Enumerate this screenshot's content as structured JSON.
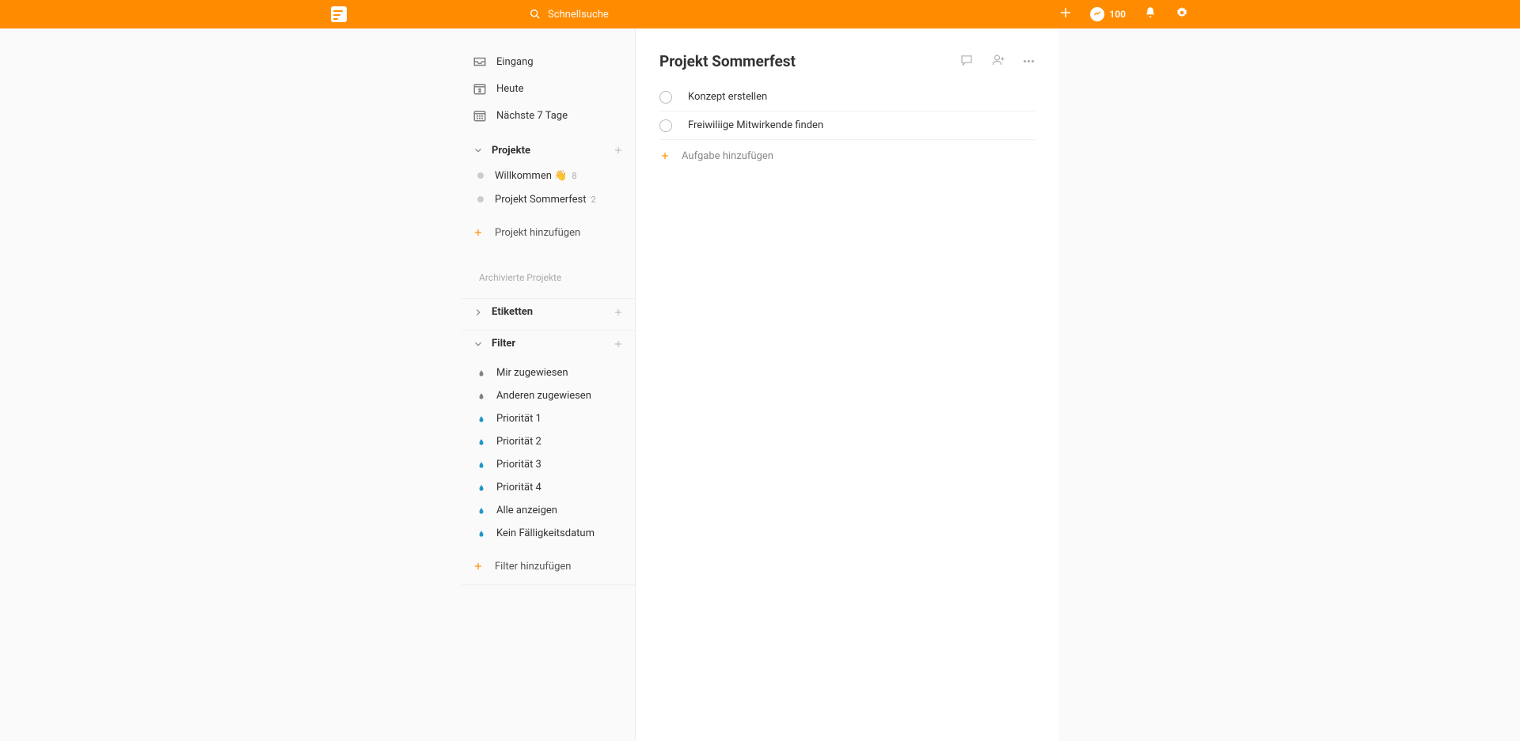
{
  "header": {
    "search_placeholder": "Schnellsuche",
    "karma_score": "100"
  },
  "sidebar": {
    "nav": {
      "inbox": "Eingang",
      "today": "Heute",
      "today_date": "2",
      "next7": "Nächste 7 Tage"
    },
    "projects": {
      "title": "Projekte",
      "items": [
        {
          "label": "Willkommen 👋",
          "count": "8"
        },
        {
          "label": "Projekt Sommerfest",
          "count": "2"
        }
      ],
      "add_label": "Projekt hinzufügen",
      "archived_label": "Archivierte Projekte"
    },
    "labels": {
      "title": "Etiketten"
    },
    "filters": {
      "title": "Filter",
      "items": [
        {
          "label": "Mir zugewiesen",
          "color": "#808080"
        },
        {
          "label": "Anderen zugewiesen",
          "color": "#808080"
        },
        {
          "label": "Priorität 1",
          "color": "#2196c9"
        },
        {
          "label": "Priorität 2",
          "color": "#2196c9"
        },
        {
          "label": "Priorität 3",
          "color": "#2196c9"
        },
        {
          "label": "Priorität 4",
          "color": "#2196c9"
        },
        {
          "label": "Alle anzeigen",
          "color": "#2196c9"
        },
        {
          "label": "Kein Fälligkeitsdatum",
          "color": "#2196c9"
        }
      ],
      "add_label": "Filter hinzufügen"
    }
  },
  "content": {
    "title": "Projekt Sommerfest",
    "tasks": [
      {
        "label": "Konzept erstellen"
      },
      {
        "label": "Freiwiliige Mitwirkende finden"
      }
    ],
    "add_task_label": "Aufgabe hinzufügen"
  }
}
